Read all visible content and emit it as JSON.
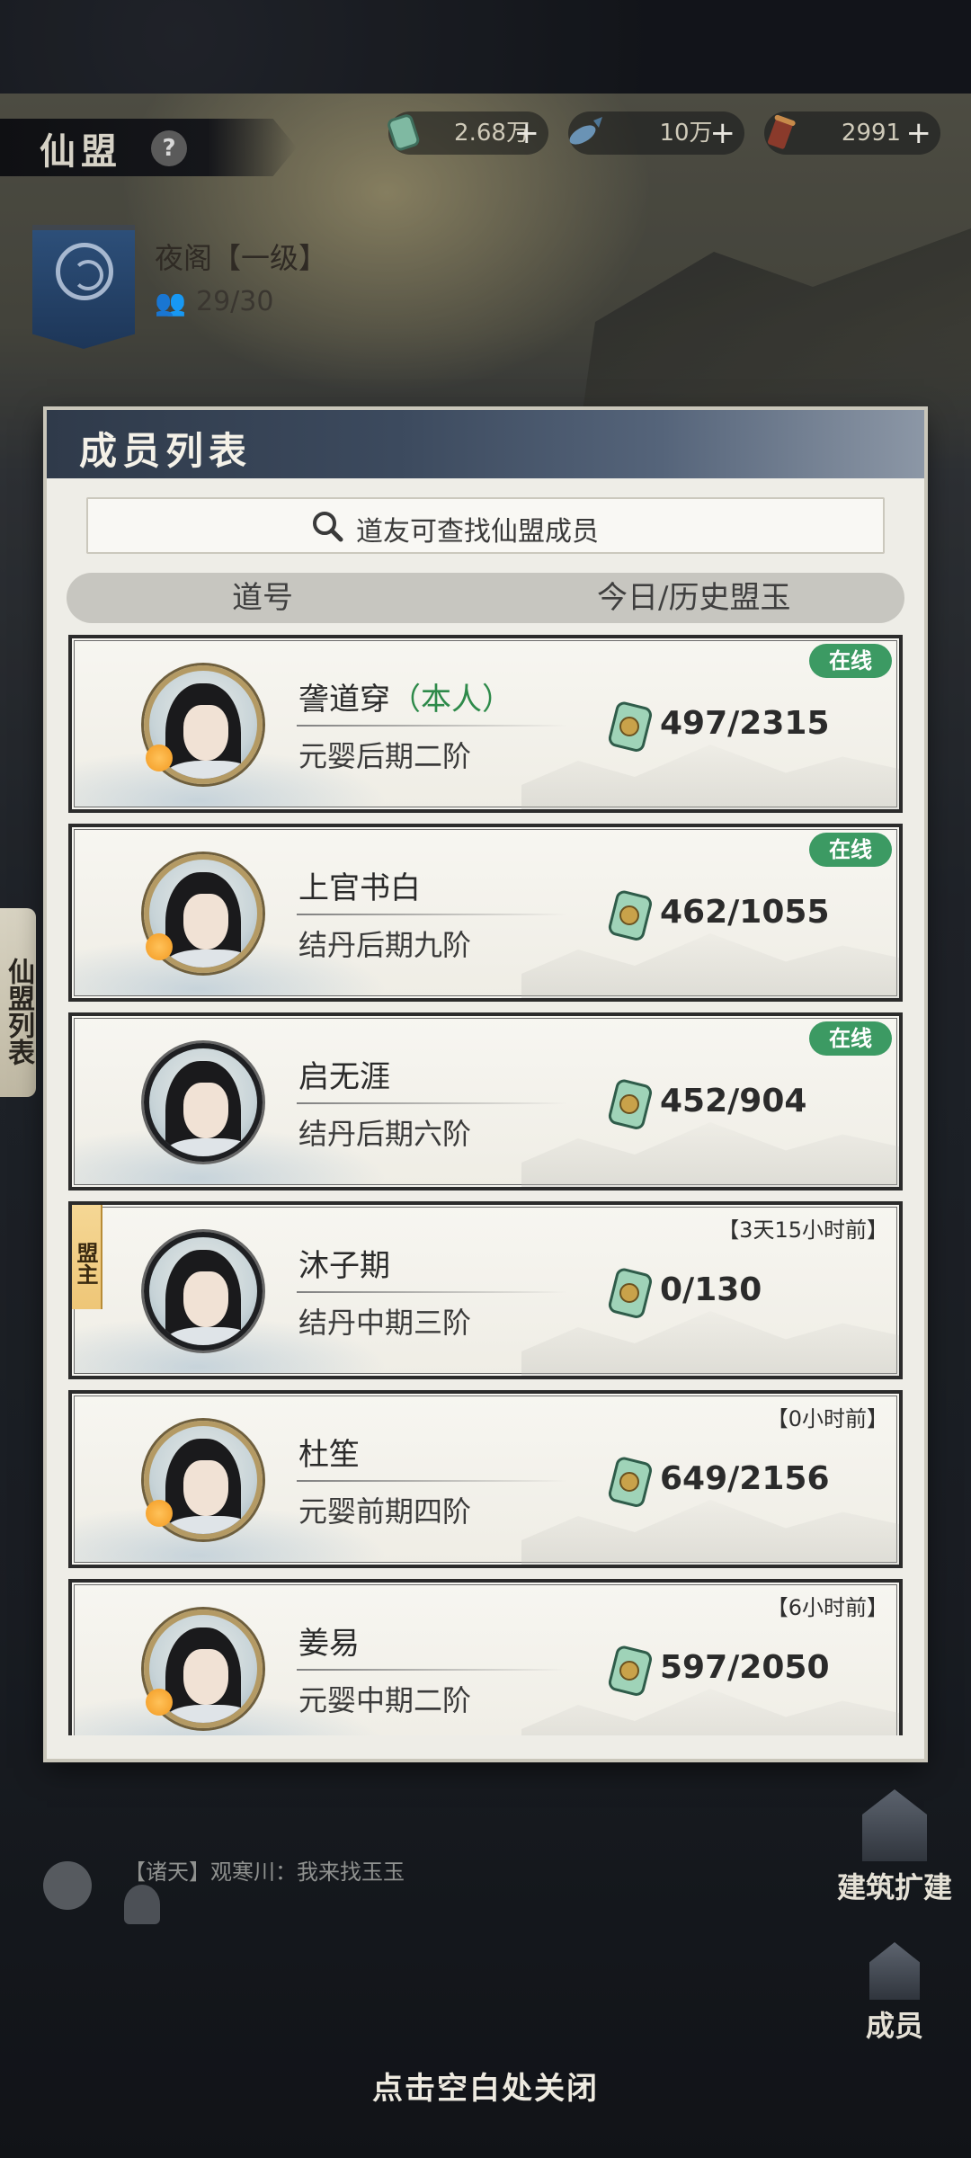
{
  "header": {
    "title": "仙盟",
    "help_label": "?",
    "resources": [
      {
        "icon": "jade-icon",
        "value": "2.68万",
        "plus": "+"
      },
      {
        "icon": "fish-icon",
        "value": "10万",
        "plus": "+"
      },
      {
        "icon": "scroll-icon",
        "value": "2991",
        "plus": "+"
      }
    ]
  },
  "guild": {
    "name": "夜阁【一级】",
    "member_count": "29/30",
    "member_icon": "people-icon"
  },
  "side_tab": "仙盟列表",
  "panel": {
    "title": "成员列表",
    "search_placeholder": "道友可查找仙盟成员",
    "col_name": "道号",
    "col_jade": "今日/历史盟玉"
  },
  "members": [
    {
      "name": "詟道穿",
      "self_tag": "（本人）",
      "rank": "元婴后期二阶",
      "jade": "497/2315",
      "status": "在线",
      "leader": "",
      "avatar_style": "gold"
    },
    {
      "name": "上官书白",
      "self_tag": "",
      "rank": "结丹后期九阶",
      "jade": "462/1055",
      "status": "在线",
      "leader": "",
      "avatar_style": "gold"
    },
    {
      "name": "启无涯",
      "self_tag": "",
      "rank": "结丹后期六阶",
      "jade": "452/904",
      "status": "在线",
      "leader": "",
      "avatar_style": "dark"
    },
    {
      "name": "沐子期",
      "self_tag": "",
      "rank": "结丹中期三阶",
      "jade": "0/130",
      "status": "【3天15小时前】",
      "leader": "盟主",
      "avatar_style": "dark"
    },
    {
      "name": "杜笙",
      "self_tag": "",
      "rank": "元婴前期四阶",
      "jade": "649/2156",
      "status": "【0小时前】",
      "leader": "",
      "avatar_style": "gold"
    },
    {
      "name": "姜易",
      "self_tag": "",
      "rank": "元婴中期二阶",
      "jade": "597/2050",
      "status": "【6小时前】",
      "leader": "",
      "avatar_style": "gold"
    }
  ],
  "chat": {
    "line": "【诸天】观寒川：我来找玉玉"
  },
  "bottom_buttons": {
    "expand": "建筑扩建",
    "members": "成员"
  },
  "close_hint": "点击空白处关闭",
  "colors": {
    "online_badge": "#3c9a63",
    "self_tag": "#2e8a4a",
    "panel_bg": "#eeede7",
    "panel_header": "#3c4a5e"
  }
}
